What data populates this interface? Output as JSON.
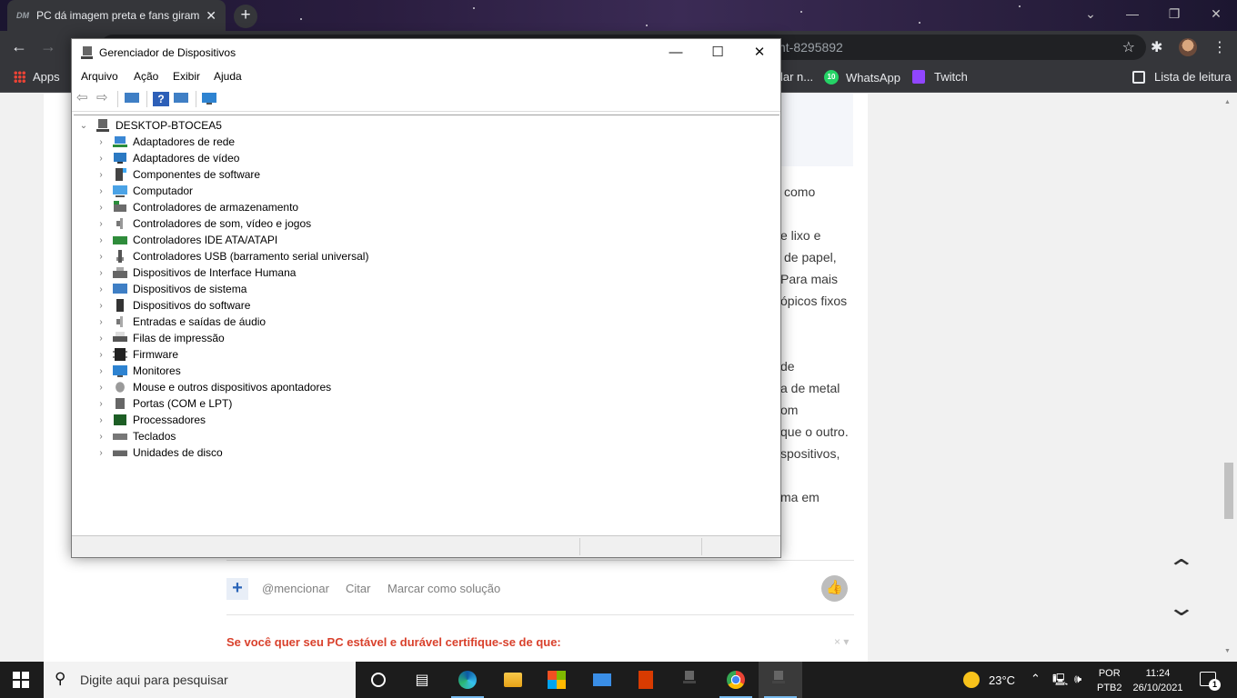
{
  "browser": {
    "tab_title": "PC dá imagem preta e fans giram",
    "tab_favicon": "DM",
    "new_tab_icon": "+",
    "url_fragment": "nt-8295892",
    "bookmarks": [
      {
        "label": "Apps"
      },
      {
        "label": "lar n..."
      },
      {
        "label": "WhatsApp",
        "badge": "10"
      },
      {
        "label": "Twitch"
      },
      {
        "label": "Lista de leitura"
      }
    ]
  },
  "page": {
    "text_fragments": [
      "como",
      "e lixo e",
      "de papel,",
      "Para mais",
      "ópicos fixos",
      "de",
      "a de metal",
      "om",
      "que o outro.",
      "spositivos,",
      "ma em"
    ],
    "actions": {
      "plus": "+",
      "mention": "@mencionar",
      "quote": "Citar",
      "solution": "Marcar como solução"
    },
    "signature": "Se você quer seu PC estável e durável certifique-se de que:",
    "signature_close": "× ▾"
  },
  "device_manager": {
    "title": "Gerenciador de Dispositivos",
    "menu": [
      "Arquivo",
      "Ação",
      "Exibir",
      "Ajuda"
    ],
    "root": "DESKTOP-BTOCEA5",
    "categories": [
      {
        "label": "Adaptadores de rede",
        "icon": "network-adapter-icon"
      },
      {
        "label": "Adaptadores de vídeo",
        "icon": "display-adapter-icon"
      },
      {
        "label": "Componentes de software",
        "icon": "software-component-icon"
      },
      {
        "label": "Computador",
        "icon": "computer-icon"
      },
      {
        "label": "Controladores de armazenamento",
        "icon": "storage-controller-icon"
      },
      {
        "label": "Controladores de som, vídeo e jogos",
        "icon": "sound-controller-icon"
      },
      {
        "label": "Controladores IDE ATA/ATAPI",
        "icon": "ide-controller-icon"
      },
      {
        "label": "Controladores USB (barramento serial universal)",
        "icon": "usb-controller-icon"
      },
      {
        "label": "Dispositivos de Interface Humana",
        "icon": "hid-icon"
      },
      {
        "label": "Dispositivos de sistema",
        "icon": "system-device-icon"
      },
      {
        "label": "Dispositivos do software",
        "icon": "software-device-icon"
      },
      {
        "label": "Entradas e saídas de áudio",
        "icon": "audio-io-icon"
      },
      {
        "label": "Filas de impressão",
        "icon": "print-queue-icon"
      },
      {
        "label": "Firmware",
        "icon": "firmware-icon"
      },
      {
        "label": "Monitores",
        "icon": "monitor-icon"
      },
      {
        "label": "Mouse e outros dispositivos apontadores",
        "icon": "mouse-icon"
      },
      {
        "label": "Portas (COM e LPT)",
        "icon": "port-icon"
      },
      {
        "label": "Processadores",
        "icon": "processor-icon"
      },
      {
        "label": "Teclados",
        "icon": "keyboard-icon"
      },
      {
        "label": "Unidades de disco",
        "icon": "disk-drive-icon"
      }
    ]
  },
  "taskbar": {
    "search_placeholder": "Digite aqui para pesquisar",
    "weather": "23°C",
    "language": "POR",
    "layout": "PTB2",
    "time": "11:24",
    "date": "26/10/2021",
    "notification_count": "1"
  }
}
